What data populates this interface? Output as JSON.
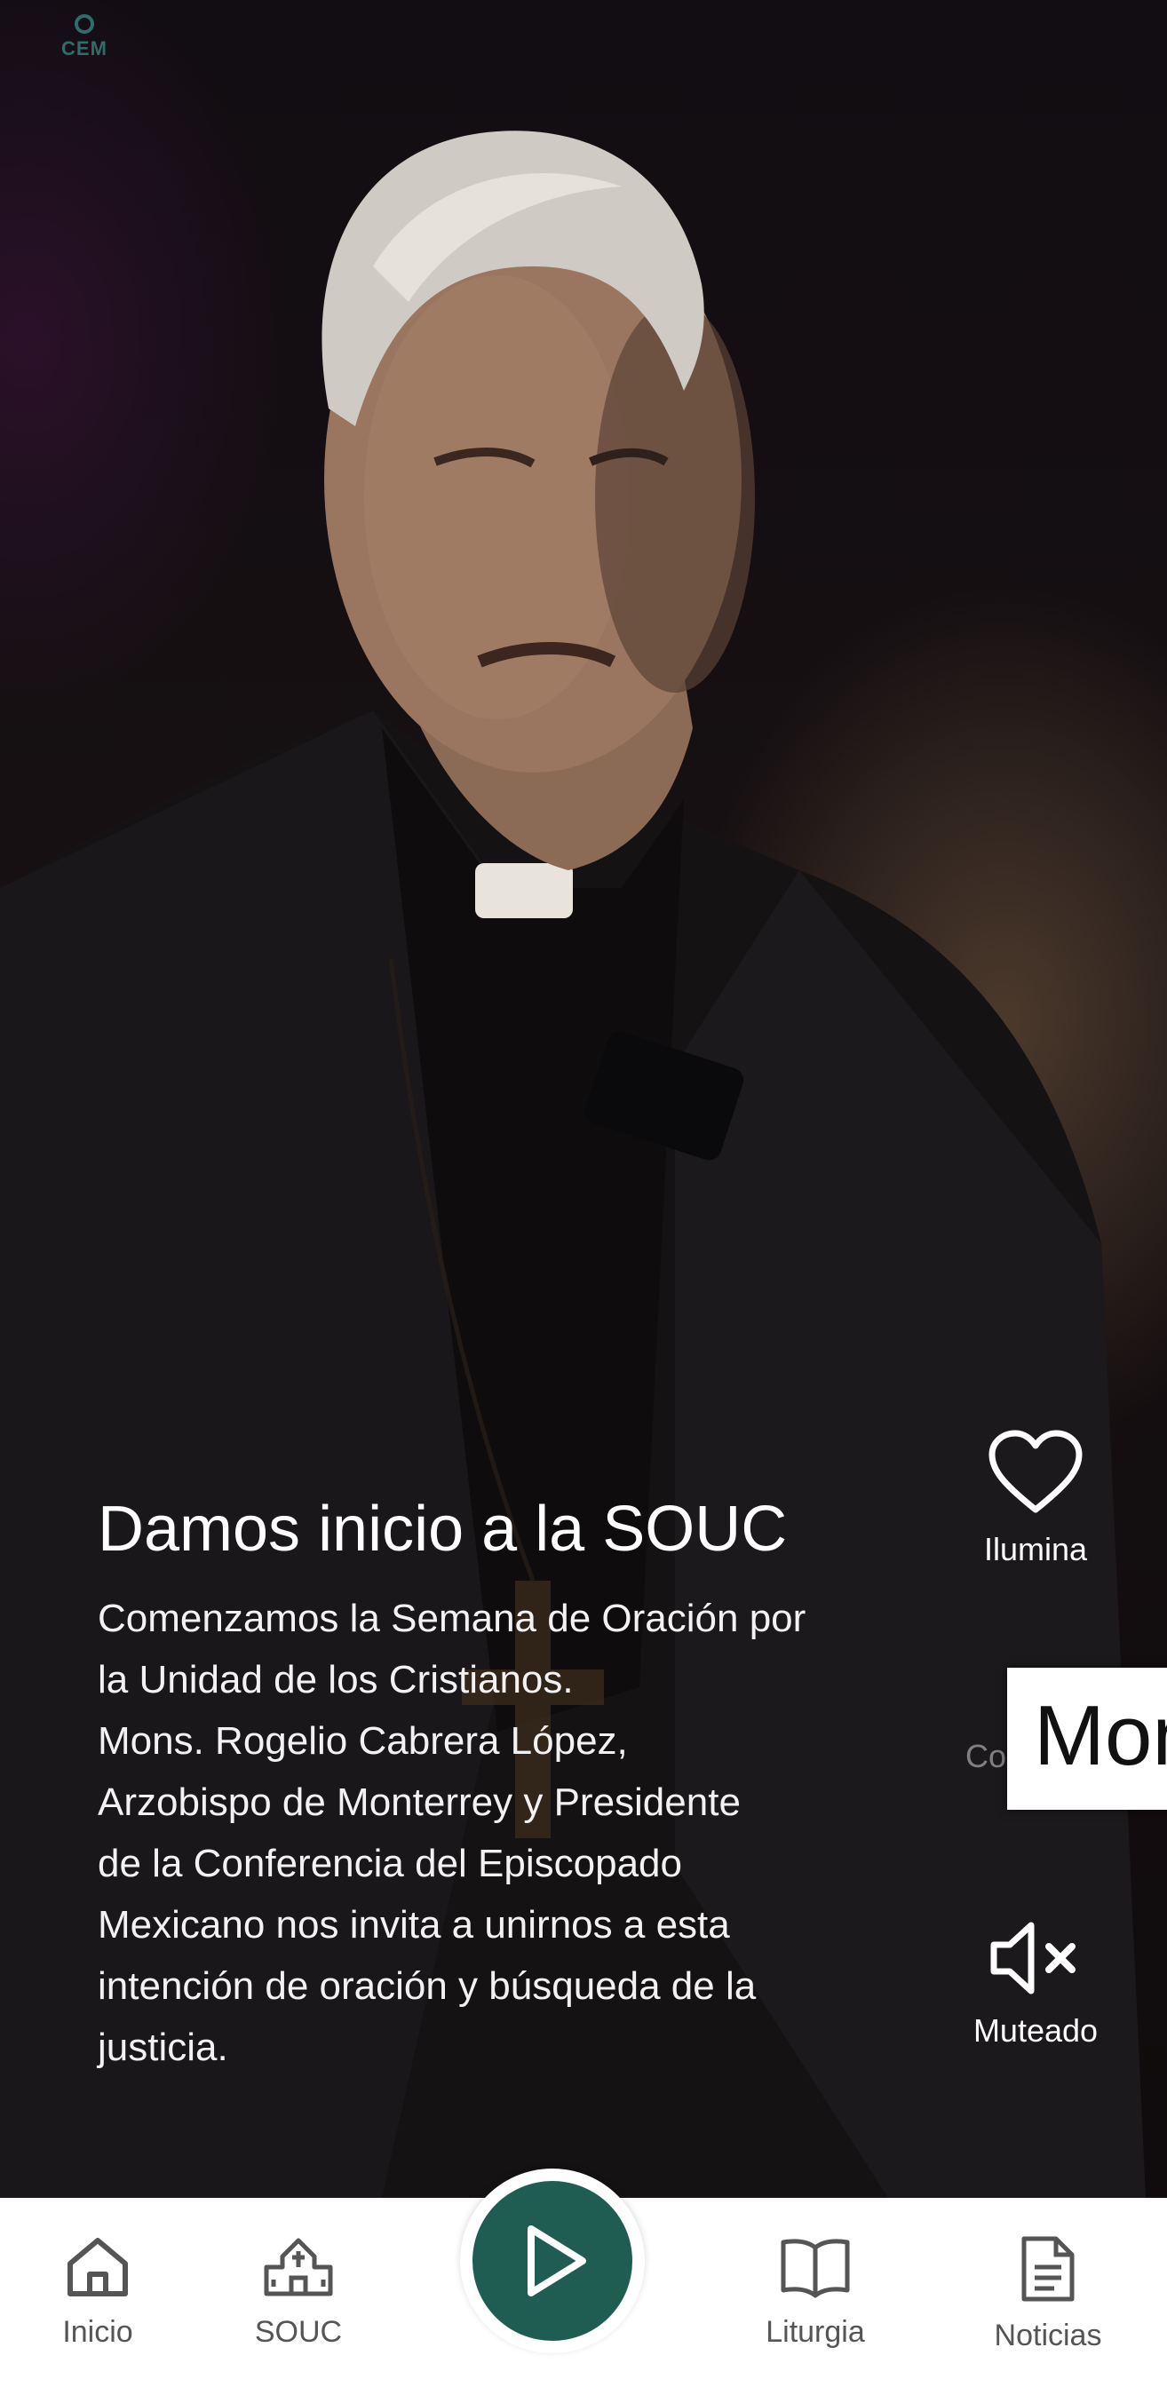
{
  "brand": {
    "logo_text": "CEM",
    "accent": "#1f5d52"
  },
  "video": {
    "title": "Damos inicio a la SOUC",
    "description": "Comenzamos la Semana de Oración por\nla Unidad de los Cristianos.\nMons. Rogelio Cabrera López,\nArzobispo de Monterrey y Presidente\nde la Conferencia del Episcopado\nMexicano nos invita a unirnos a esta\nintención de oración y búsqueda de la\njusticia."
  },
  "actions": {
    "like": {
      "label": "Ilumina",
      "icon": "heart-icon"
    },
    "share": {
      "label": "Compartir",
      "icon": "share-icon"
    },
    "mute": {
      "label": "Muteado",
      "icon": "speaker-muted-icon"
    }
  },
  "tooltip": {
    "text": "Mon"
  },
  "bottom_nav": {
    "items": [
      {
        "label": "Inicio",
        "icon": "home-icon"
      },
      {
        "label": "SOUC",
        "icon": "church-icon"
      },
      {
        "label": "",
        "icon": "play-icon"
      },
      {
        "label": "Liturgia",
        "icon": "book-icon"
      },
      {
        "label": "Noticias",
        "icon": "document-icon"
      }
    ]
  }
}
